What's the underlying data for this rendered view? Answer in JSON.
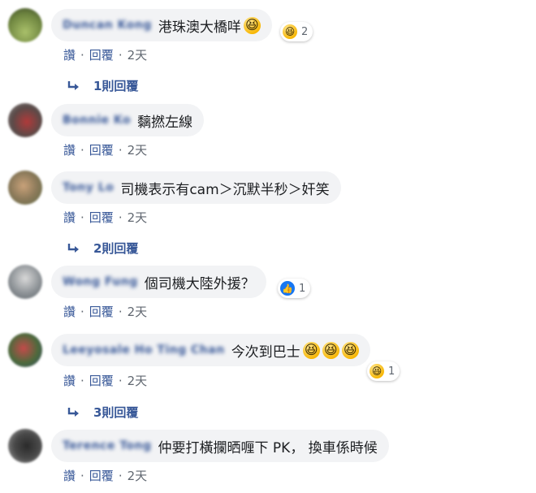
{
  "comments": [
    {
      "author": "Duncan Kong",
      "text": "港珠澳大橋咩",
      "emoji": [
        "😆"
      ],
      "reaction": {
        "type": "haha",
        "count": "2"
      },
      "actions": {
        "like": "讚",
        "reply": "回覆",
        "sep": "·",
        "time": "2天"
      },
      "replies_label": "1則回覆"
    },
    {
      "author": "Bonnie Ko",
      "text": "黐撚左線",
      "emoji": [],
      "actions": {
        "like": "讚",
        "reply": "回覆",
        "sep": "·",
        "time": "2天"
      }
    },
    {
      "author": "Tony Lo",
      "text": "司機表示有cam＞沉默半秒＞奸笑",
      "emoji": [],
      "actions": {
        "like": "讚",
        "reply": "回覆",
        "sep": "·",
        "time": "2天"
      },
      "replies_label": "2則回覆"
    },
    {
      "author": "Wong Fung",
      "text": "個司機大陸外援？",
      "emoji": [],
      "reaction": {
        "type": "like",
        "count": "1"
      },
      "actions": {
        "like": "讚",
        "reply": "回覆",
        "sep": "·",
        "time": "2天"
      }
    },
    {
      "author": "Leeyosale Ho Ting Chan",
      "text": "今次到巴士",
      "emoji": [
        "😆",
        "😆",
        "😆"
      ],
      "reaction": {
        "type": "haha",
        "count": "1"
      },
      "actions": {
        "like": "讚",
        "reply": "回覆",
        "sep": "·",
        "time": "2天"
      },
      "replies_label": "3則回覆"
    },
    {
      "author": "Terence Tong",
      "text": "仲要打橫攔晒喱下 PK， 換車係時候",
      "emoji": [],
      "actions": {
        "like": "讚",
        "reply": "回覆",
        "sep": "·",
        "time": "2天"
      }
    }
  ],
  "colors": {
    "link": "#385898",
    "bubble": "#f2f3f5",
    "meta": "#606770",
    "like_blue": "#1877f2",
    "haha_yellow": "#f7b500"
  }
}
